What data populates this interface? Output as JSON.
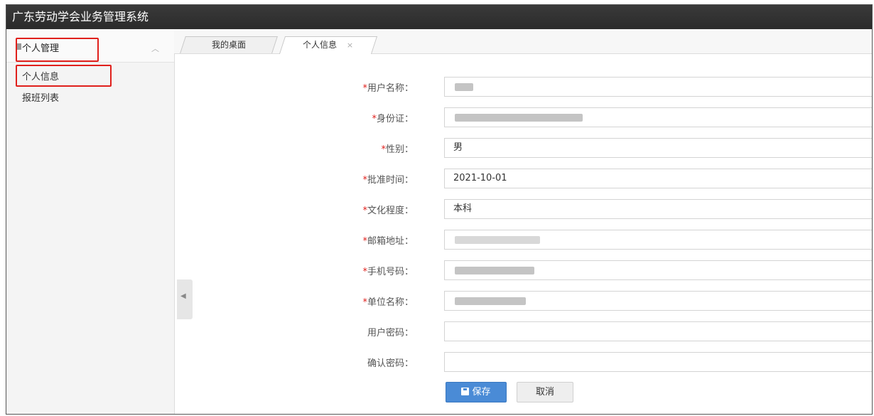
{
  "app": {
    "title": "广东劳动学会业务管理系统"
  },
  "sidebar": {
    "group_label": "个人管理",
    "items": [
      {
        "label": "个人信息"
      },
      {
        "label": "报班列表"
      }
    ]
  },
  "tabs": [
    {
      "label": "我的桌面"
    },
    {
      "label": "个人信息",
      "close": "×"
    }
  ],
  "form": {
    "fields": [
      {
        "required": "*",
        "label": "用户名称：",
        "value": ""
      },
      {
        "required": "*",
        "label": "身份证：",
        "value": ""
      },
      {
        "required": "*",
        "label": "性别：",
        "value": "男"
      },
      {
        "required": "*",
        "label": "批准时间：",
        "value": "2021-10-01"
      },
      {
        "required": "*",
        "label": "文化程度：",
        "value": "本科"
      },
      {
        "required": "*",
        "label": "邮箱地址：",
        "value": ""
      },
      {
        "required": "*",
        "label": "手机号码：",
        "value": ""
      },
      {
        "required": "*",
        "label": "单位名称：",
        "value": ""
      },
      {
        "required": "",
        "label": "用户密码：",
        "value": ""
      },
      {
        "required": "",
        "label": "确认密码：",
        "value": ""
      }
    ],
    "save_label": "保存",
    "cancel_label": "取消"
  },
  "colors": {
    "accent": "#4a8bd6",
    "required_star": "#e0201c",
    "highlight_box": "#e0201c",
    "header_bg": "#2b2b2b"
  },
  "icons": {
    "sidebar_group": "document-icon",
    "sidebar_toggle": "chevron-up-icon",
    "collapse_handle": "triangle-left-icon",
    "save": "save-icon"
  }
}
